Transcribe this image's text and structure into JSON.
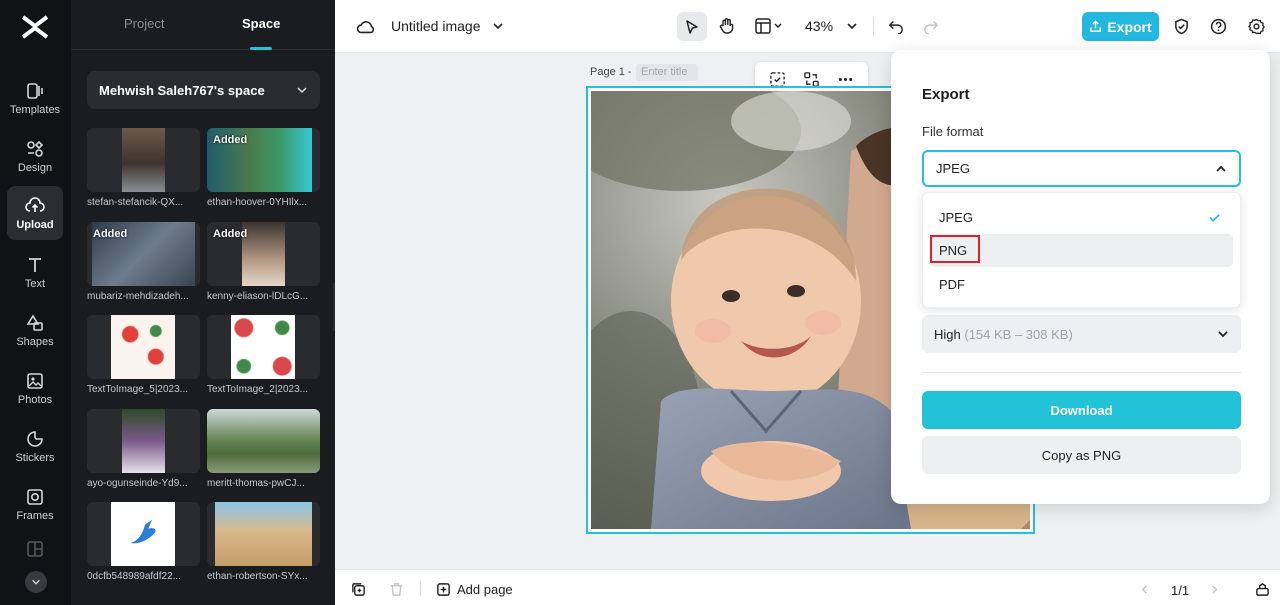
{
  "rail": {
    "items": [
      {
        "label": "Templates",
        "icon": "templates-icon"
      },
      {
        "label": "Design",
        "icon": "design-icon"
      },
      {
        "label": "Upload",
        "icon": "upload-icon"
      },
      {
        "label": "Text",
        "icon": "text-icon"
      },
      {
        "label": "Shapes",
        "icon": "shapes-icon"
      },
      {
        "label": "Photos",
        "icon": "photos-icon"
      },
      {
        "label": "Stickers",
        "icon": "stickers-icon"
      },
      {
        "label": "Frames",
        "icon": "frames-icon"
      },
      {
        "label": "Collage",
        "icon": "collage-icon"
      }
    ]
  },
  "panel": {
    "tabs": [
      {
        "label": "Project"
      },
      {
        "label": "Space"
      }
    ],
    "space_name": "Mehwish Saleh767's space",
    "added_badge": "Added",
    "assets": [
      {
        "name": "stefan-stefancik-QX..."
      },
      {
        "name": "ethan-hoover-0YHIlx..."
      },
      {
        "name": "mubariz-mehdizadeh..."
      },
      {
        "name": "kenny-eliason-lDLcG..."
      },
      {
        "name": "TextToImage_5|2023..."
      },
      {
        "name": "TextToImage_2|2023..."
      },
      {
        "name": "ayo-ogunseinde-Yd9..."
      },
      {
        "name": "meritt-thomas-pwCJ..."
      },
      {
        "name": "0dcfb548989afdf22..."
      },
      {
        "name": "ethan-robertson-SYx..."
      }
    ]
  },
  "topbar": {
    "title": "Untitled image",
    "zoom": "43%",
    "export_label": "Export"
  },
  "canvas": {
    "page_label": "Page 1 -",
    "title_placeholder": "Enter title"
  },
  "bottombar": {
    "add_page": "Add page",
    "pager": "1/1"
  },
  "export_panel": {
    "title": "Export",
    "file_format_label": "File format",
    "selected_format": "JPEG",
    "options": [
      {
        "label": "JPEG"
      },
      {
        "label": "PNG"
      },
      {
        "label": "PDF"
      }
    ],
    "quality_label": "High",
    "quality_range": "(154 KB – 308 KB)",
    "download_label": "Download",
    "copy_label": "Copy as PNG"
  },
  "colors": {
    "accent": "#22c2d8",
    "rail_bg": "#111214",
    "panel_bg": "#1b1c1f",
    "highlight": "#e0202a"
  }
}
